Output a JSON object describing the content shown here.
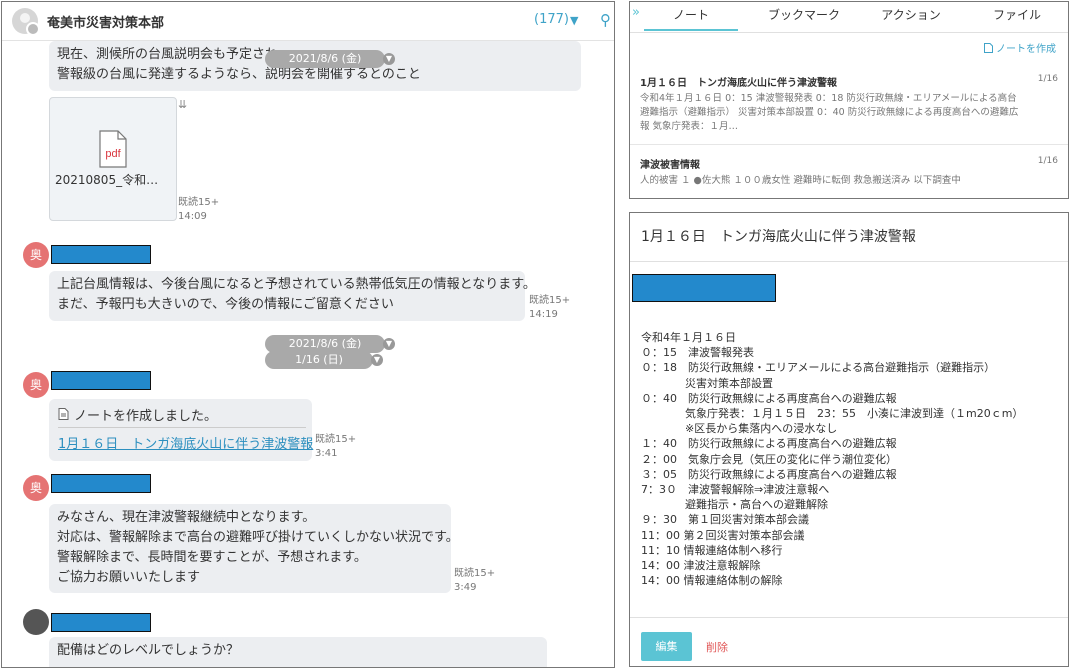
{
  "chat": {
    "room_title": "奄美市災害対策本部",
    "room_count": "(177)",
    "messages": {
      "m1_line1": "現在、測候所の台風説明会も予定され",
      "m1_line2": "警報級の台風に発達するようなら、説明会を開催するとのこと",
      "date_pill_1": "2021/8/6 (金)",
      "file_name": "20210805_令和…",
      "file_type": "pdf",
      "file_read": "既読15+",
      "file_time": "14:09",
      "m2_line1": "上記台風情報は、今後台風になると予想されている熱帯低気圧の情報となります。",
      "m2_line2": "まだ、予報円も大きいので、今後の情報にご留意ください",
      "m2_read": "既読15+",
      "m2_time": "14:19",
      "date_pill_2": "2021/8/6 (金)",
      "date_pill_3": "1/16 (日)",
      "note_made": "ノートを作成しました。",
      "note_link": "1月１６日　トンガ海底火山に伴う津波警報",
      "note_read": "既読15+",
      "note_time": "3:41",
      "m3_line1": "みなさん、現在津波警報継続中となります。",
      "m3_line2": "対応は、警報解除まで高台の避難呼び掛けていくしかない状況です。",
      "m3_line3": "警報解除まで、長時間を要すことが、予想されます。",
      "m3_line4": "ご協力お願いいたします",
      "m3_read": "既読15+",
      "m3_time": "3:49",
      "m4_line1": "配備はどのレベルでしょうか？",
      "avatar_label": "奥"
    }
  },
  "notes_panel": {
    "tabs": [
      "ノート",
      "ブックマーク",
      "アクション",
      "ファイル"
    ],
    "create_label": "ノートを作成",
    "items": [
      {
        "title": "1月１６日　トンガ海底火山に伴う津波警報",
        "date": "1/16",
        "body_line1": "令和4年１月１６日 0：15 津波警報発表 0：18 防災行政無線・エリアメールによる高台",
        "body_line2": "避難指示（避難指示） 災害対策本部設置 0：40 防災行政無線による再度高台への避難広",
        "body_line3": "報 気象庁発表：１月…"
      },
      {
        "title": "津波被害情報",
        "date": "1/16",
        "body_line1": "人的被害 １ ●佐大熊 １００歳女性 避難時に転倒 救急搬送済み 以下調査中"
      }
    ]
  },
  "detail": {
    "title": "1月１６日　トンガ海底火山に伴う津波警報",
    "lines": [
      "令和4年１月１６日",
      "０：15　津波警報発表",
      "０：18　防災行政無線・エリアメールによる高台避難指示（避難指示）",
      "　　　　災害対策本部設置",
      "０：40　防災行政無線による再度高台への避難広報",
      "　　　　気象庁発表：１月１５日　23：55　小湊に津波到達（１m20ｃm）",
      "　　　　※区長から集落内への浸水なし",
      "１：40　防災行政無線による再度高台への避難広報",
      "２：00　気象庁会見（気圧の変化に伴う潮位変化）",
      "３：05　防災行政無線による再度高台への避難広報",
      "7：3０　津波警報解除⇒津波注意報へ",
      "　　　　避難指示・高台への避難解除",
      "９：30　第１回災害対策本部会議",
      "11：00 第２回災害対策本部会議",
      "11：10 情報連絡体制へ移行",
      "14：00 津波注意報解除",
      "14：00 情報連絡体制の解除"
    ],
    "edit_label": "編集",
    "delete_label": "削除"
  },
  "colors": {
    "accent": "#5bc4d4",
    "link": "#2c8fbf",
    "redact": "#2389cc",
    "avatar": "#e57373",
    "delete": "#e05656"
  }
}
